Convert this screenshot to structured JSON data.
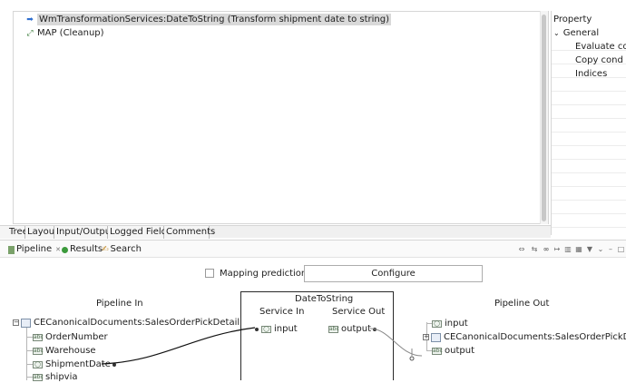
{
  "editor": {
    "steps": [
      {
        "label": "WmTransformationServices:DateToString (Transform shipment date to string)",
        "icon": "arrow-right-icon",
        "selected": true
      },
      {
        "label": "MAP (Cleanup)",
        "icon": "map-icon",
        "selected": false
      }
    ],
    "tabs": [
      "Tree",
      "Layout",
      "Input/Output",
      "Logged Fields",
      "Comments"
    ]
  },
  "properties": {
    "title": "Property",
    "group": "General",
    "items": [
      "Evaluate co",
      "Copy cond",
      "Indices"
    ]
  },
  "views": {
    "tabs": [
      {
        "label": "Pipeline",
        "icon": "pipeline-icon",
        "active": true,
        "close": "✕"
      },
      {
        "label": "Results",
        "icon": "results-icon",
        "active": false
      },
      {
        "label": "Search",
        "icon": "search-icon",
        "active": false
      }
    ]
  },
  "mapping": {
    "predictions_label": "Mapping predictions",
    "predictions_checked": false,
    "configure_label": "Configure"
  },
  "pipeline_in": {
    "heading": "Pipeline In",
    "root": "CECanonicalDocuments:SalesOrderPickDetail",
    "fields": [
      "OrderNumber",
      "Warehouse",
      "ShipmentDate",
      "shipvia"
    ]
  },
  "service": {
    "title": "DateToString",
    "in_heading": "Service In",
    "out_heading": "Service Out",
    "in_field": "input",
    "out_field": "output"
  },
  "pipeline_out": {
    "heading": "Pipeline Out",
    "fields": [
      "input",
      "CECanonicalDocuments:SalesOrderPickDetail",
      "output"
    ]
  },
  "colors": {
    "accent_arrow": "#2f6fd0",
    "link_line": "#111111"
  }
}
